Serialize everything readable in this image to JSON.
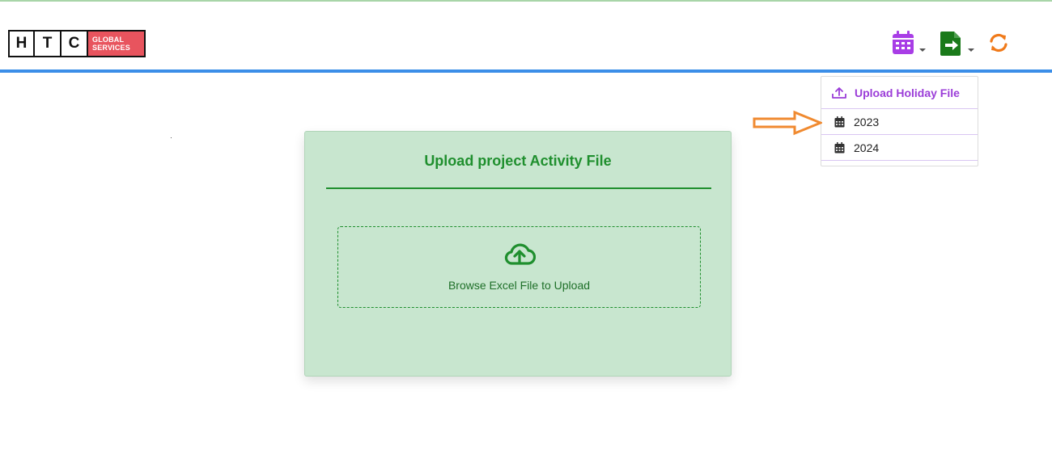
{
  "header": {
    "logo": {
      "letters": [
        "H",
        "T",
        "C"
      ],
      "brand_line1": "GLOBAL",
      "brand_line2": "SERVICES"
    },
    "tools": [
      {
        "icon": "calendar-icon",
        "color": "#a83de6",
        "has_dropdown": true
      },
      {
        "icon": "file-export-icon",
        "color": "#1a7a1a",
        "has_dropdown": true
      },
      {
        "icon": "sync-icon",
        "color": "#f07a1a",
        "has_dropdown": false
      }
    ],
    "accent_color": "#3b8ee8"
  },
  "holiday_menu": {
    "upload_label": "Upload Holiday File",
    "upload_icon": "upload-icon",
    "years": [
      {
        "label": "2023",
        "icon": "calendar-icon"
      },
      {
        "label": "2024",
        "icon": "calendar-icon"
      }
    ]
  },
  "upload_card": {
    "title": "Upload project Activity File",
    "dropzone_text": "Browse Excel File to Upload",
    "dropzone_icon": "cloud-upload-icon",
    "color": "#1f8f2e"
  }
}
